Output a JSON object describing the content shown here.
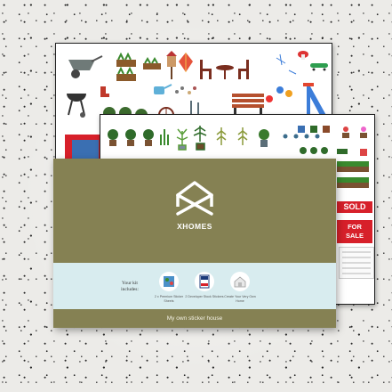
{
  "brand": {
    "name": "XHOMES"
  },
  "kit": {
    "intro": "Your kit includes:"
  },
  "items": [
    {
      "caption": "2 x Premium Sticker Sheets"
    },
    {
      "caption": "2 Developer Stock Stickers"
    },
    {
      "caption": "Create Your Very Own Home"
    }
  ],
  "footer": {
    "text": "My own sticker house"
  },
  "tags": {
    "sold": "SOLD",
    "for_sale_1": "FOR",
    "for_sale_2": "SALE"
  },
  "colors": {
    "card": "#858153",
    "band": "#d8ecef",
    "tag": "#d7202a"
  }
}
